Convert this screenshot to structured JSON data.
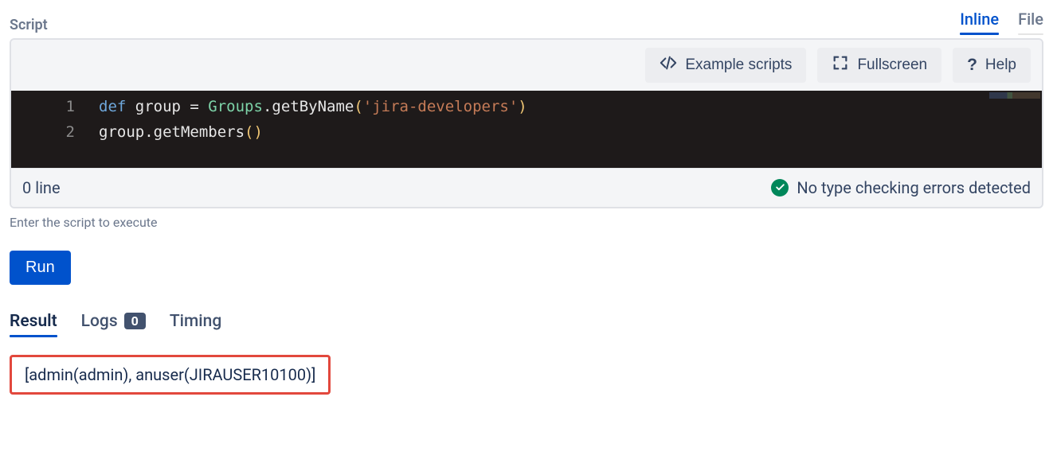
{
  "header": {
    "label": "Script",
    "view_tabs": {
      "inline": "Inline",
      "file": "File"
    }
  },
  "toolbar": {
    "examples": "Example scripts",
    "fullscreen": "Fullscreen",
    "help": "Help"
  },
  "code": {
    "lines": [
      {
        "n": "1",
        "tokens": [
          "def ",
          "group ",
          "= ",
          "Groups",
          ".",
          "getByName",
          "(",
          "'jira-developers'",
          ")"
        ]
      },
      {
        "n": "2",
        "tokens": [
          "group",
          ".",
          "getMembers",
          "(",
          ")"
        ]
      }
    ]
  },
  "status": {
    "left": "0 line",
    "right": "No type checking errors detected"
  },
  "hint": "Enter the script to execute",
  "run": "Run",
  "result_tabs": {
    "result": "Result",
    "logs": "Logs",
    "logs_count": "0",
    "timing": "Timing"
  },
  "result_value": "[admin(admin), anuser(JIRAUSER10100)]"
}
